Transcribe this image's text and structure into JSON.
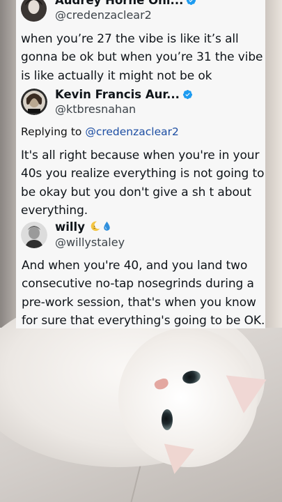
{
  "tweets": [
    {
      "name": "Audrey Horne Onl...",
      "handle": "@credenzaclear2",
      "verified": true,
      "text": "when you’re 27 the vibe is like it’s all gonna be ok but when you’re 31 the vibe is like actually it might not be ok"
    },
    {
      "name": "Kevin Francis Aur...",
      "handle": "@ktbresnahan",
      "verified": true,
      "reply_prefix": "Replying to",
      "reply_to": "@credenzaclear2",
      "text": "It's all right because when you're in your 40s you realize everything is not going to be okay but you don't give a sh t about everything."
    },
    {
      "name": "willy",
      "handle": "@willystaley",
      "name_emojis": [
        "crescent-moon-icon",
        "droplet-icon"
      ],
      "text": "And when you're 40, and you land two consecutive no-tap nosegrinds during a pre-work session, that's when you know for sure that everything's going to be OK."
    }
  ],
  "colors": {
    "card_bg": "#f7f7f7",
    "verified_blue": "#1d9bf0",
    "mention_blue": "#1d4ea3",
    "text": "#0f1419",
    "handle": "#3c4349"
  }
}
